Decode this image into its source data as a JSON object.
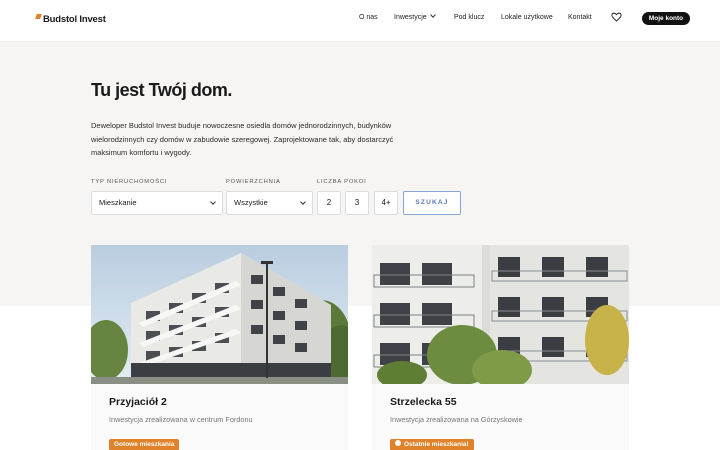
{
  "header": {
    "logo_text": "Budstol Invest",
    "nav": {
      "about": "O nas",
      "investments": "Inwestycje",
      "turnkey": "Pod klucz",
      "commercial": "Lokale użytkowe",
      "contact": "Kontakt"
    },
    "account_button": "Moje konto"
  },
  "hero": {
    "title": "Tu jest Twój dom.",
    "lead": "Deweloper Budstol Invest buduje nowoczesne osiedla domów jednorodzinnych, budynków wielorodzinnych czy domów w zabudowie szeregowej. Zaprojektowane tak, aby dostarczyć maksimum komfortu i wygody."
  },
  "filters": {
    "type_label": "TYP NIERUCHOMOŚCI",
    "type_value": "Mieszkanie",
    "area_label": "POWIERZCHNIA",
    "area_value": "Wszystkie",
    "rooms_label": "LICZBA POKOI",
    "rooms_options": [
      "2",
      "3",
      "4+"
    ],
    "search_label": "SZUKAJ"
  },
  "cards": [
    {
      "title": "Przyjaciół 2",
      "description": "Inwestycja zrealizowana w centrum Fordonu",
      "badge": "Gotowe mieszkania"
    },
    {
      "title": "Strzelecka 55",
      "description": "Inwestycja zrealizowana na Górzyskowie",
      "badge": "Ostatnie mieszkania!"
    }
  ],
  "colors": {
    "accent": "#e0822a",
    "search_button": "#5576bd",
    "account_button_bg": "#111111"
  },
  "icons": {
    "favorites": "heart-icon",
    "dropdown": "chevron-down-icon"
  }
}
